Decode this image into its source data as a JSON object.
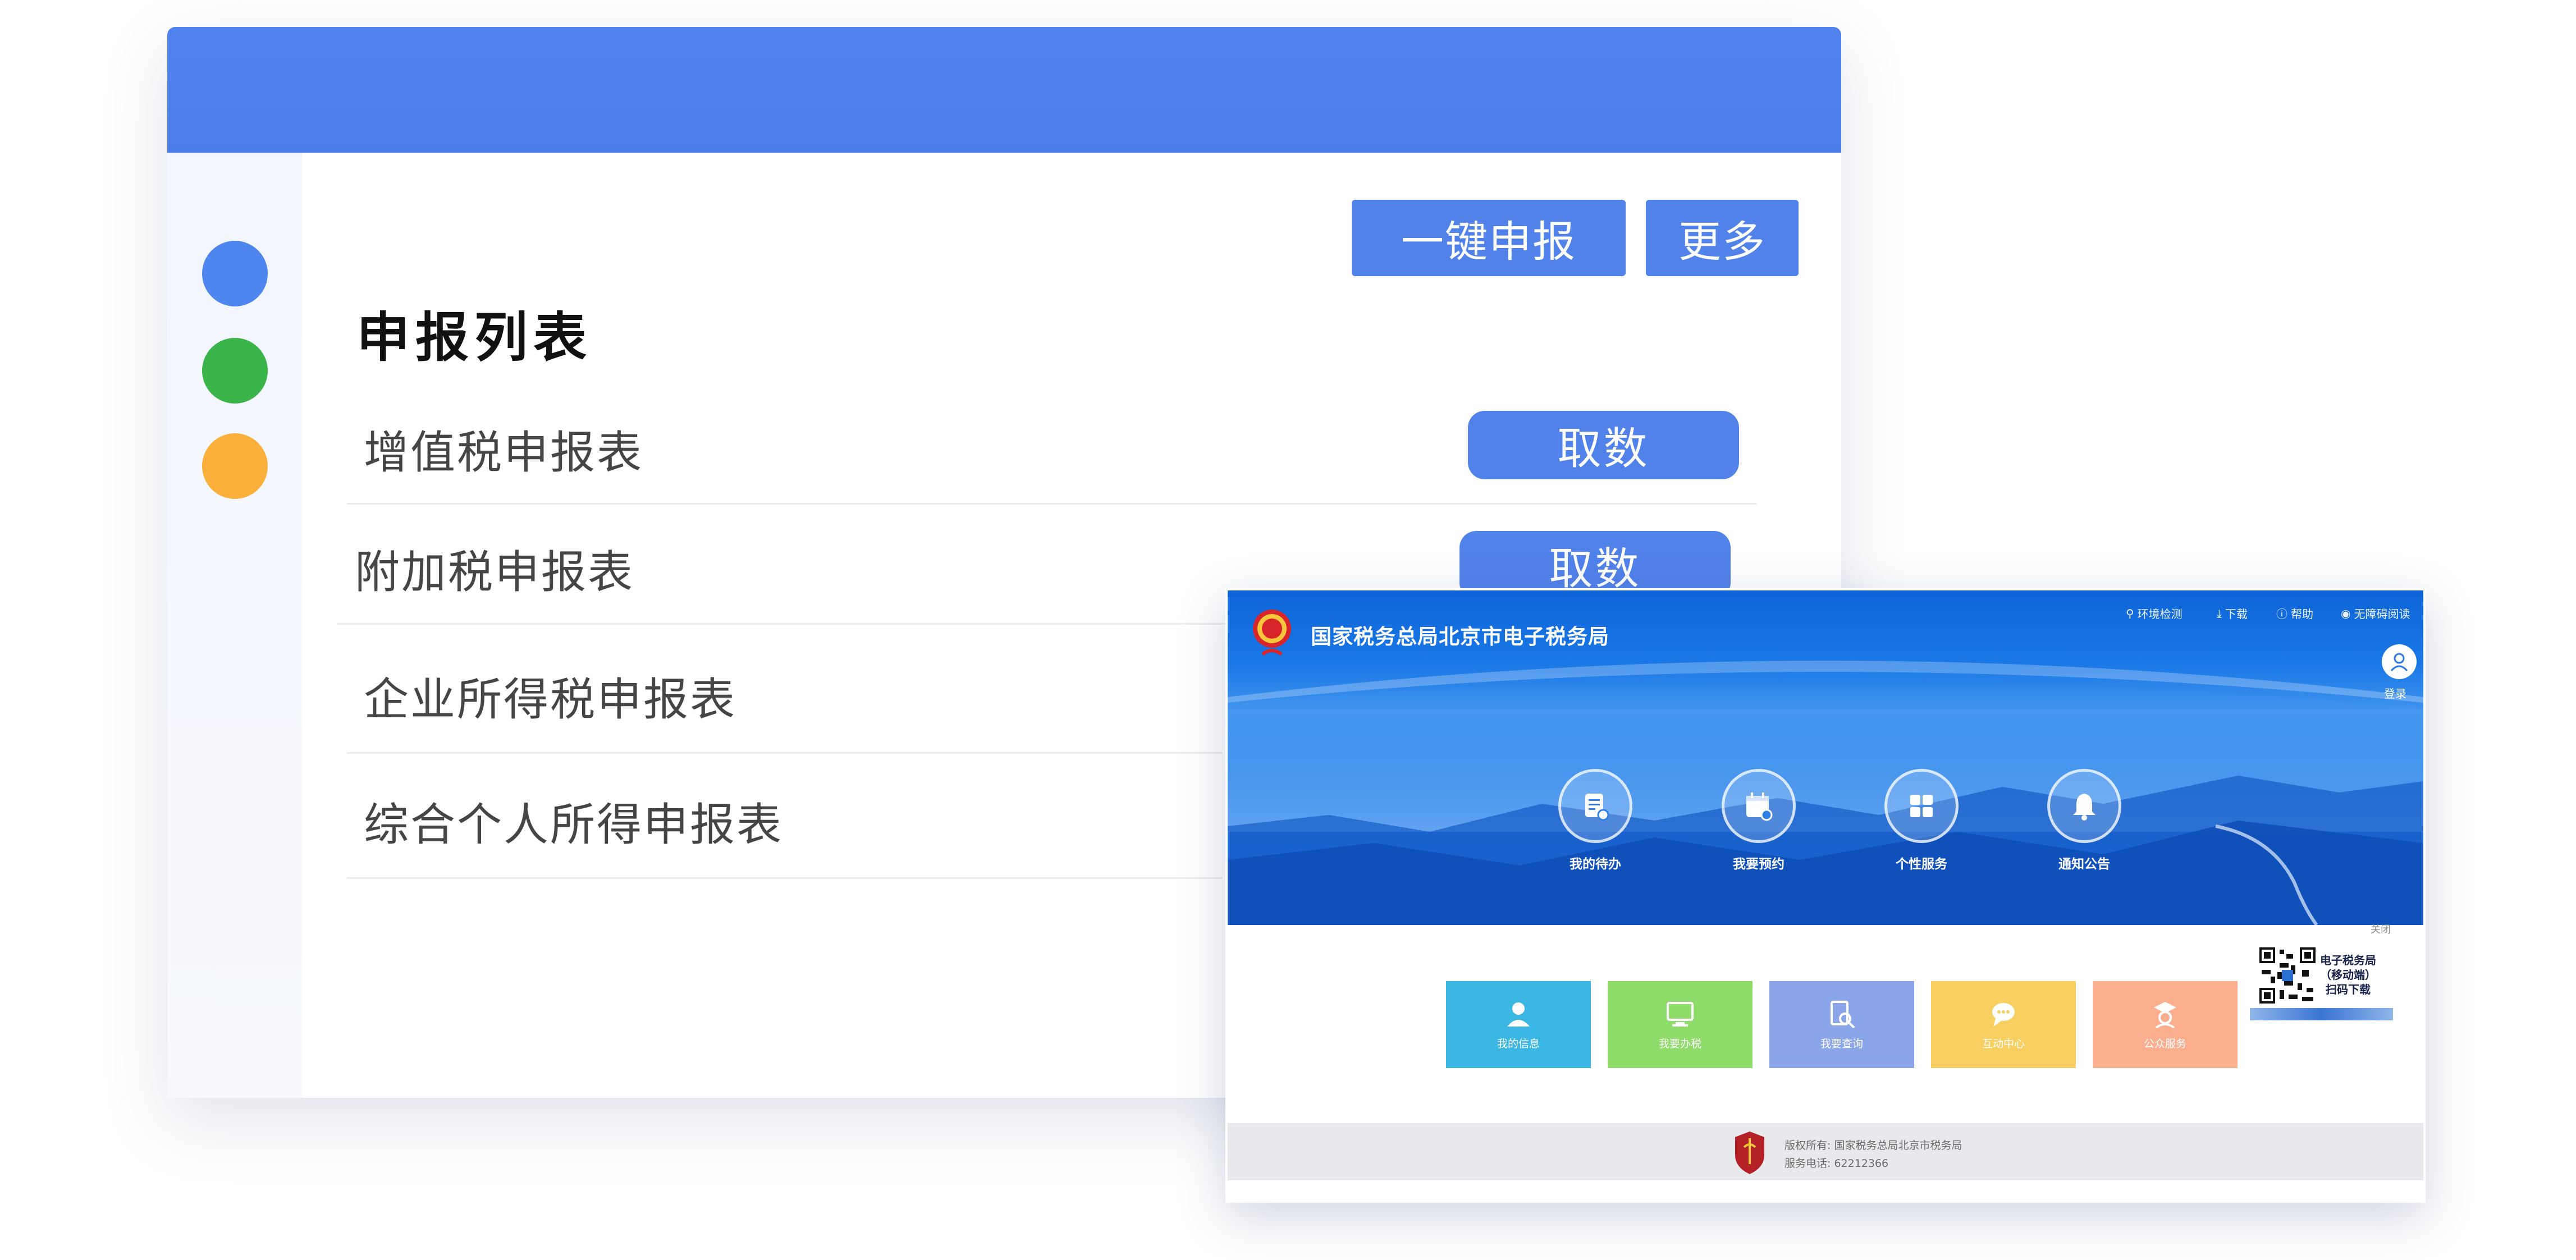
{
  "colors": {
    "primary": "#5182ea",
    "dot_blue": "#4f85ef",
    "dot_green": "#3bb54a",
    "dot_orange": "#fbb03b"
  },
  "declaration": {
    "buttons": {
      "one_click": "一键申报",
      "more": "更多"
    },
    "title": "申报列表",
    "rows": [
      {
        "label": "增值税申报表",
        "action": "取数"
      },
      {
        "label": "附加税申报表",
        "action": "取数"
      },
      {
        "label": "企业所得税申报表"
      },
      {
        "label": "综合个人所得申报表"
      }
    ]
  },
  "tax_site": {
    "title": "国家税务总局北京市电子税务局",
    "top_links": [
      {
        "label": "环境检测",
        "icon": "search-icon"
      },
      {
        "label": "下载",
        "icon": "download-icon"
      },
      {
        "label": "帮助",
        "icon": "help-icon"
      },
      {
        "label": "无障碍阅读",
        "icon": "eye-icon"
      }
    ],
    "login": "登录",
    "circles": [
      {
        "label": "我的待办",
        "icon": "todo-icon"
      },
      {
        "label": "我要预约",
        "icon": "calendar-icon"
      },
      {
        "label": "个性服务",
        "icon": "grid-icon"
      },
      {
        "label": "通知公告",
        "icon": "bell-icon"
      }
    ],
    "close": "关闭",
    "tiles": [
      {
        "label": "我的信息",
        "color": "#3ab7e3",
        "icon": "user-icon"
      },
      {
        "label": "我要办税",
        "color": "#8fdc6a",
        "icon": "monitor-icon"
      },
      {
        "label": "我要查询",
        "color": "#8ba6e8",
        "icon": "search-doc-icon"
      },
      {
        "label": "互动中心",
        "color": "#f6cf60",
        "icon": "chat-icon"
      },
      {
        "label": "公众服务",
        "color": "#fbae8e",
        "icon": "service-icon"
      }
    ],
    "qr": {
      "line1": "电子税务局",
      "line2": "（移动端）",
      "line3": "扫码下载"
    },
    "footer": {
      "copyright": "版权所有: 国家税务总局北京市税务局",
      "phone": "服务电话: 62212366"
    }
  }
}
